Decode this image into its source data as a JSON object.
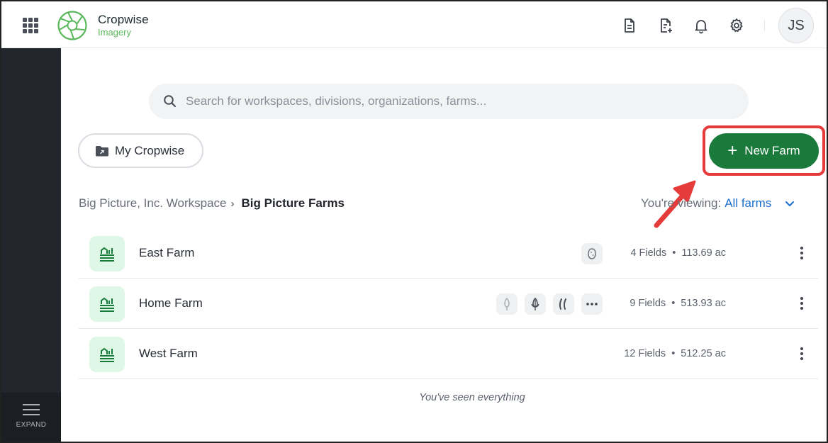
{
  "header": {
    "brand_name": "Cropwise",
    "brand_sub": "Imagery",
    "avatar_initials": "JS",
    "icons": [
      "apps-grid-icon",
      "document-icon",
      "document-add-icon",
      "bell-icon",
      "gear-icon"
    ]
  },
  "sidebar": {
    "expand_label": "EXPAND"
  },
  "search": {
    "placeholder": "Search for workspaces, divisions, organizations, farms..."
  },
  "my_cropwise": {
    "label": "My Cropwise"
  },
  "new_farm": {
    "label": "New Farm",
    "plus": "+"
  },
  "breadcrumb": {
    "workspace": "Big Picture, Inc. Workspace",
    "separator": "›",
    "current": "Big Picture Farms"
  },
  "viewing": {
    "label": "You're viewing:",
    "value": "All farms"
  },
  "farms": [
    {
      "name": "East Farm",
      "crops": [
        "potato-icon"
      ],
      "fields": "4 Fields",
      "area": "113.69 ac"
    },
    {
      "name": "Home Farm",
      "crops": [
        "wheat-icon",
        "corn-icon",
        "bean-icon",
        "more-icon"
      ],
      "fields": "9 Fields",
      "area": "513.93 ac"
    },
    {
      "name": "West Farm",
      "crops": [],
      "fields": "12 Fields",
      "area": "512.25 ac"
    }
  ],
  "stats_separator": "•",
  "footer": {
    "end_message": "You've seen everything"
  },
  "colors": {
    "primary_green": "#1a7a3c",
    "farm_icon_bg": "#dff7e6",
    "link_blue": "#1a6fd1",
    "highlight_red": "#e53b3b",
    "sidebar_bg": "#23272d"
  }
}
